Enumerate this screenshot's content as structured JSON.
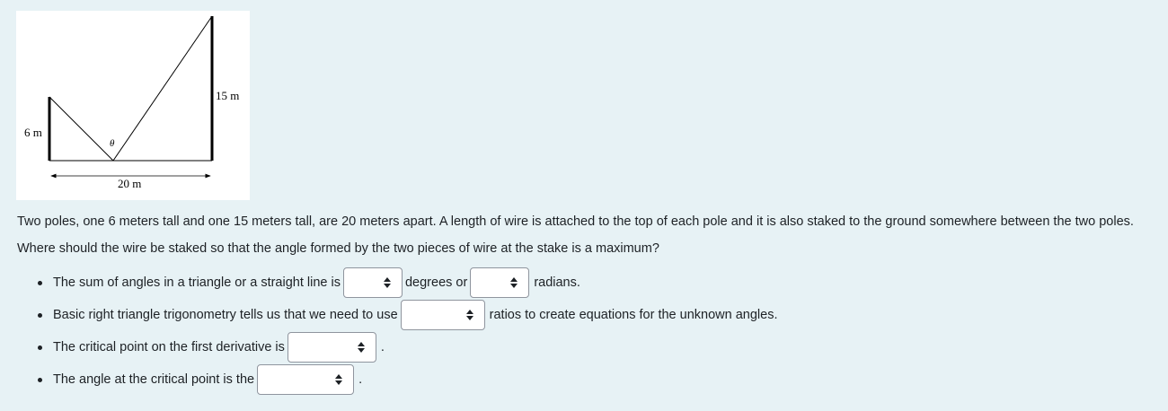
{
  "figure": {
    "left_pole_label": "6 m",
    "right_pole_label": "15 m",
    "distance_label": "20 m",
    "angle_label": "θ"
  },
  "problem": {
    "text": "Two poles, one 6 meters tall and one 15 meters tall, are 20 meters apart. A length of wire is attached to the top of each pole and it is also staked to the ground somewhere between the two poles. Where should the wire be staked so that the angle formed by the two pieces of wire at the stake is a maximum?"
  },
  "questions": [
    {
      "prefix": "The sum of angles in a triangle or a straight line is",
      "middle": "degrees or",
      "suffix": "radians.",
      "selects": [
        "",
        ""
      ]
    },
    {
      "prefix": "Basic right triangle trigonometry tells us that we need to use",
      "suffix": "ratios to create equations for the unknown angles.",
      "selects": [
        ""
      ]
    },
    {
      "prefix": "The critical point on the first derivative is",
      "suffix": ".",
      "selects": [
        ""
      ]
    },
    {
      "prefix": "The angle at the critical point is the",
      "suffix": ".",
      "selects": [
        ""
      ]
    }
  ],
  "icons": {
    "select_arrow": "up-down-caret-icon"
  }
}
